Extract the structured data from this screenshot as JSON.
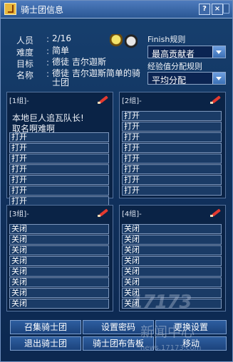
{
  "window": {
    "title": "骑士团信息",
    "help_label": "?",
    "close_label": "×"
  },
  "info": {
    "rows": [
      {
        "label": "人员",
        "value": "2/16"
      },
      {
        "label": "难度",
        "value": "简单"
      },
      {
        "label": "目标",
        "value": "德徒 吉尔迦斯"
      },
      {
        "label": "名称",
        "value": "德徒 吉尔迦斯简单的骑士团"
      }
    ],
    "colon": ":"
  },
  "finish_rule": {
    "label": "Finish规则",
    "selected": "最高贡献者"
  },
  "exp_rule": {
    "label": "经验值分配规则",
    "selected": "平均分配"
  },
  "groups": [
    {
      "header": "[1组]-",
      "notes": [
        "本地巨人追瓦队长!",
        "取名啊难啊"
      ],
      "slots": [
        "打开",
        "打开",
        "打开",
        "打开",
        "打开",
        "打开",
        "打开"
      ]
    },
    {
      "header": "[2组]-",
      "notes": [],
      "slots": [
        "打开",
        "打开",
        "打开",
        "打开",
        "打开",
        "打开",
        "打开",
        "打开"
      ]
    },
    {
      "header": "[3组]-",
      "notes": [],
      "slots": [
        "关闭",
        "关闭",
        "关闭",
        "关闭",
        "关闭",
        "关闭",
        "关闭",
        "关闭"
      ]
    },
    {
      "header": "[4组]-",
      "notes": [],
      "slots": [
        "关闭",
        "关闭",
        "关闭",
        "关闭",
        "关闭",
        "关闭",
        "关闭",
        "关闭"
      ]
    }
  ],
  "buttons": {
    "summon": "召集骑士团",
    "set_password": "设置密码",
    "change_settings": "更换设置",
    "leave": "退出骑士团",
    "board": "骑士团布告板",
    "move": "移动"
  },
  "watermark": {
    "logo": "17173",
    "news": "新闻中心",
    "url": "news.17173.com"
  }
}
